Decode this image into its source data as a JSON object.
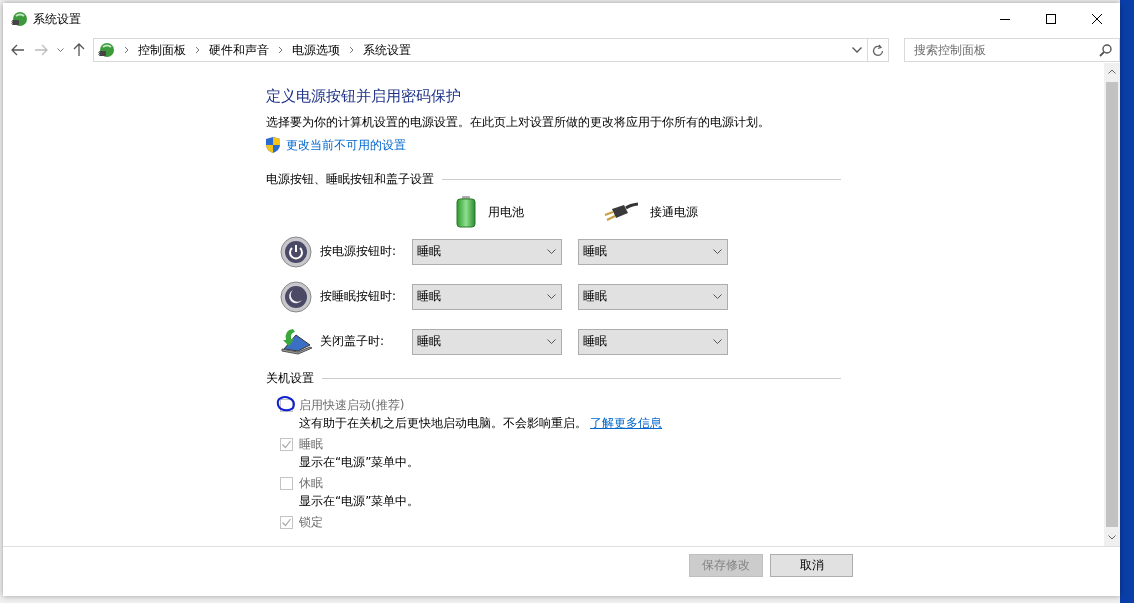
{
  "window": {
    "title": "系统设置"
  },
  "address_bar": {
    "breadcrumbs": [
      "控制面板",
      "硬件和声音",
      "电源选项",
      "系统设置"
    ]
  },
  "search": {
    "placeholder": "搜索控制面板"
  },
  "page": {
    "heading": "定义电源按钮并启用密码保护",
    "description": "选择要为你的计算机设置的电源设置。在此页上对设置所做的更改将应用于你所有的电源计划。",
    "admin_link": "更改当前不可用的设置"
  },
  "power_buttons": {
    "section_title": "电源按钮、睡眠按钮和盖子设置",
    "columns": [
      {
        "label": "用电池",
        "kind": "battery"
      },
      {
        "label": "接通电源",
        "kind": "plug"
      }
    ],
    "rows": [
      {
        "kind": "power",
        "label": "按电源按钮时:",
        "values": [
          "睡眠",
          "睡眠"
        ]
      },
      {
        "kind": "sleep",
        "label": "按睡眠按钮时:",
        "values": [
          "睡眠",
          "睡眠"
        ]
      },
      {
        "kind": "lid",
        "label": "关闭盖子时:",
        "values": [
          "睡眠",
          "睡眠"
        ]
      }
    ]
  },
  "shutdown": {
    "section_title": "关机设置",
    "options": [
      {
        "label": "启用快速启动(推荐)",
        "description": "这有助于在关机之后更快地启动电脑。不会影响重启。",
        "link": "了解更多信息",
        "checked": false,
        "disabled": true,
        "annotated": true
      },
      {
        "label": "睡眠",
        "description": "显示在“电源”菜单中。",
        "checked": true,
        "disabled": true,
        "annotated": false
      },
      {
        "label": "休眠",
        "description": "显示在“电源”菜单中。",
        "checked": false,
        "disabled": true,
        "annotated": false
      },
      {
        "label": "锁定",
        "checked": true,
        "disabled": true,
        "annotated": false
      }
    ]
  },
  "buttons": [
    {
      "label": "保存修改",
      "disabled": true
    },
    {
      "label": "取消",
      "disabled": false
    }
  ]
}
